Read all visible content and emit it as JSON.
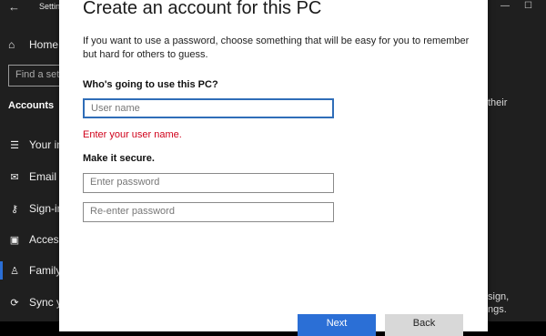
{
  "window": {
    "title": "Settings",
    "minimize_icon": "minimize-icon",
    "maximize_icon": "maximize-icon"
  },
  "sidebar": {
    "home_label": "Home",
    "search_placeholder": "Find a setting",
    "section_label": "Accounts",
    "items": [
      {
        "label": "Your info",
        "icon": "person-card-icon"
      },
      {
        "label": "Email & accounts",
        "icon": "mail-icon"
      },
      {
        "label": "Sign-in options",
        "icon": "key-icon"
      },
      {
        "label": "Access work or school",
        "icon": "briefcase-icon"
      },
      {
        "label": "Family & other users",
        "icon": "person-icon"
      },
      {
        "label": "Sync your settings",
        "icon": "sync-icon"
      }
    ]
  },
  "background_text": {
    "their": "their",
    "sign": "sign,",
    "ngs": "ngs."
  },
  "dialog": {
    "title": "Create an account for this PC",
    "description": "If you want to use a password, choose something that will be easy for you to remember but hard for others to guess.",
    "user_heading": "Who's going to use this PC?",
    "username_placeholder": "User name",
    "username_error": "Enter your user name.",
    "secure_heading": "Make it secure.",
    "password_placeholder": "Enter password",
    "reenter_placeholder": "Re-enter password",
    "next_label": "Next",
    "back_label": "Back"
  },
  "colors": {
    "accent": "#2b6fd6",
    "error": "#d0021b",
    "focus_border": "#2f6db8"
  }
}
